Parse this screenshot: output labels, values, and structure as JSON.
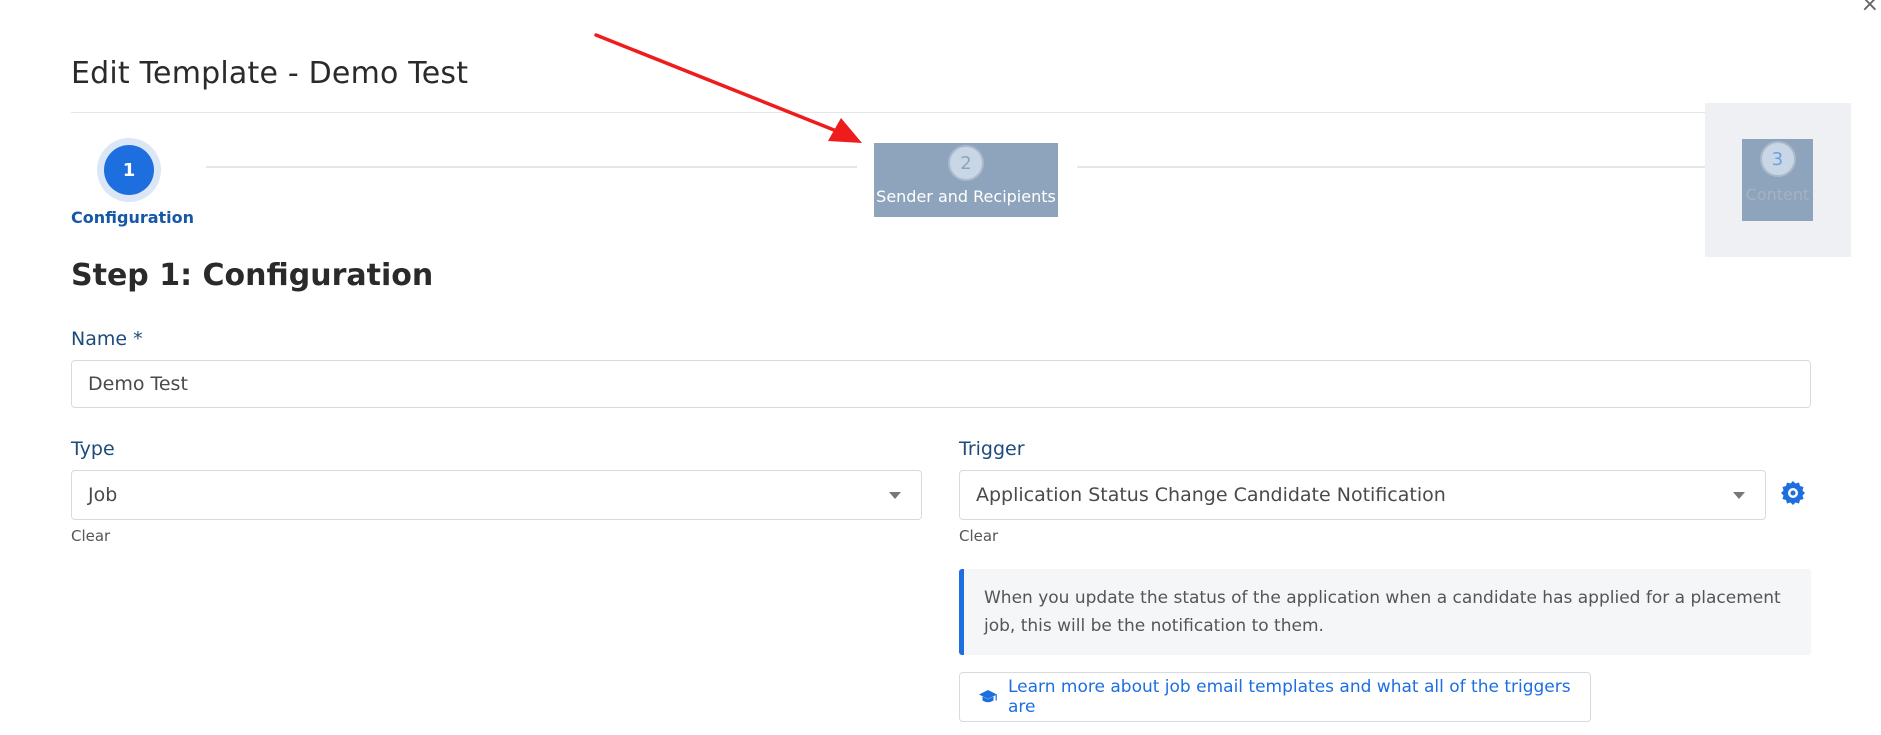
{
  "modal": {
    "title": "Edit Template - Demo Test",
    "close_glyph": "×"
  },
  "stepper": {
    "steps": [
      {
        "number": "1",
        "label": "Configuration",
        "state": "active"
      },
      {
        "number": "2",
        "label": "Sender and Recipients",
        "state": "highlighted"
      },
      {
        "number": "3",
        "label": "Content",
        "state": "highlighted"
      }
    ]
  },
  "section": {
    "title": "Step 1: Configuration"
  },
  "form": {
    "name": {
      "label": "Name *",
      "value": "Demo Test"
    },
    "type": {
      "label": "Type",
      "value": "Job",
      "clear": "Clear"
    },
    "trigger": {
      "label": "Trigger",
      "value": "Application Status Change Candidate Notification",
      "clear": "Clear"
    }
  },
  "info": {
    "text": "When you update the status of the application when a candidate has applied for a placement job, this will be the notification to them."
  },
  "learn_more": {
    "label": "Learn more about job email templates and what all of the triggers are",
    "icon": "graduation-cap-icon"
  },
  "colors": {
    "accent": "#1d6fe0",
    "label_text": "#1e4b7a",
    "arrow": "#ee1c1c",
    "highlight": "#8ea4bc"
  }
}
